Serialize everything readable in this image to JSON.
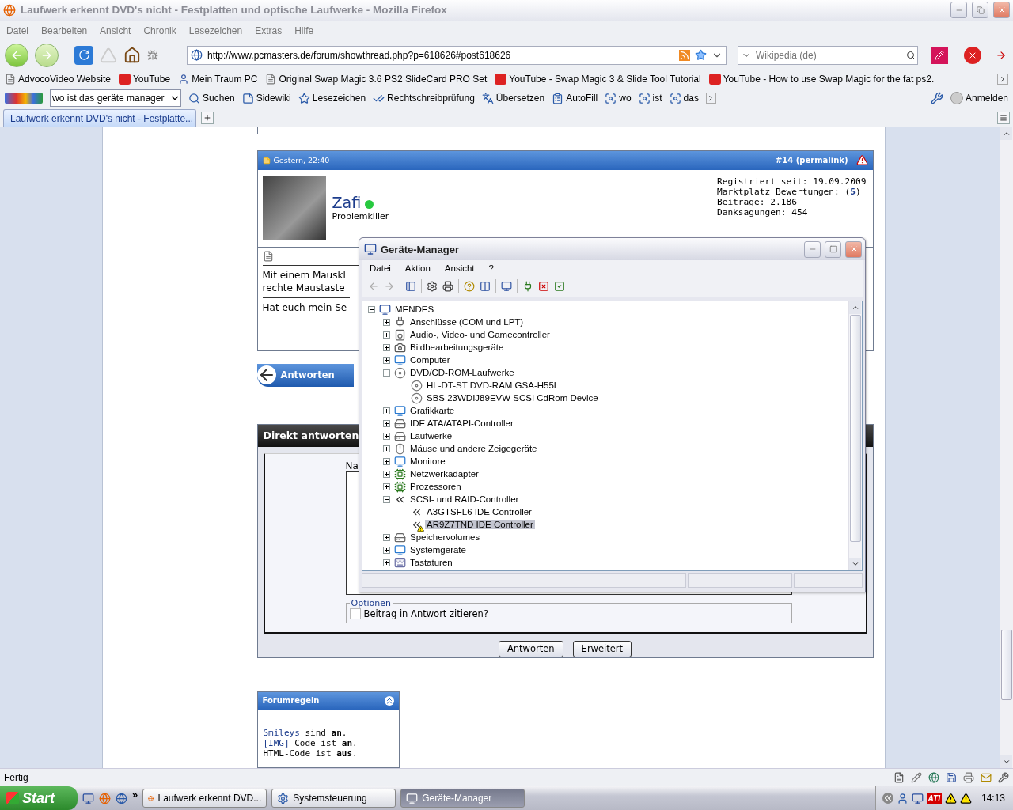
{
  "browser": {
    "title": "Laufwerk erkennt DVD's nicht - Festplatten und optische Laufwerke - Mozilla Firefox",
    "menu": [
      "Datei",
      "Bearbeiten",
      "Ansicht",
      "Chronik",
      "Lesezeichen",
      "Extras",
      "Hilfe"
    ],
    "url": "http://www.pcmasters.de/forum/showthread.php?p=618626#post618626",
    "search_placeholder": "Wikipedia (de)",
    "bookmarks": [
      {
        "label": "AdvocoVideo Website",
        "kind": "page"
      },
      {
        "label": "YouTube",
        "kind": "video"
      },
      {
        "label": "Mein Traum PC",
        "kind": "person"
      },
      {
        "label": "Original Swap Magic 3.6 PS2 SlideCard PRO Set",
        "kind": "page"
      },
      {
        "label": "YouTube - Swap Magic 3 & Slide Tool Tutorial",
        "kind": "video"
      },
      {
        "label": "YouTube - How to use Swap Magic for the fat ps2.",
        "kind": "video"
      }
    ],
    "google_query": "wo ist das geräte manager",
    "google_items": [
      {
        "label": "Suchen",
        "kind": "search"
      },
      {
        "label": "Sidewiki",
        "kind": "note"
      },
      {
        "label": "Lesezeichen",
        "kind": "star"
      },
      {
        "label": "Rechtschreibprüfung",
        "kind": "check"
      },
      {
        "label": "Übersetzen",
        "kind": "translate"
      },
      {
        "label": "AutoFill",
        "kind": "form"
      },
      {
        "label": "wo",
        "kind": "find"
      },
      {
        "label": "ist",
        "kind": "find"
      },
      {
        "label": "das",
        "kind": "find"
      }
    ],
    "sign_in": "Anmelden",
    "tabs": [
      {
        "label": "Laufwerk erkennt DVD's nicht - Festplatte...",
        "selected": true
      }
    ],
    "status": "Fertig"
  },
  "post": {
    "date": "Gestern, 22:40",
    "permalink": "#14 (permalink)",
    "user": "Zafi",
    "online": true,
    "rank": "Problemkiller",
    "stats": [
      "Registriert seit: 19.09.2009",
      "Marktplatz Bewertungen: (**5**)",
      "Beiträge: 2.186",
      "Danksagungen: 454"
    ],
    "lines": [
      "Mit einem Mauskl",
      "rechte Maustaste",
      "Hat euch mein Se"
    ]
  },
  "reply_button": "Antworten",
  "quick_reply": {
    "title": "Direkt antworten",
    "label": "Na",
    "options_legend": "Optionen",
    "quote_label": "Beitrag in Antwort zitieren?",
    "quote_checked": false,
    "buttons": [
      "Antworten",
      "Erweitert"
    ]
  },
  "forum_rules": {
    "title": "Forumregeln",
    "lines": [
      {
        "link": "Smileys",
        "text": " sind **an**."
      },
      {
        "link": "[IMG]",
        "text": " Code ist **an**."
      },
      {
        "text": "HTML-Code ist **aus**."
      }
    ]
  },
  "device_manager": {
    "title": "Geräte-Manager",
    "menu": [
      "Datei",
      "Aktion",
      "Ansicht",
      "?"
    ],
    "tree": {
      "label": "MENDES",
      "kind": "computer",
      "expanded": true,
      "selected": false,
      "children": [
        {
          "label": "Anschlüsse (COM und LPT)",
          "kind": "plug",
          "expanded": false,
          "selected": false
        },
        {
          "label": "Audio-, Video- und Gamecontroller",
          "kind": "speaker",
          "expanded": false,
          "selected": false
        },
        {
          "label": "Bildbearbeitungsgeräte",
          "kind": "camera",
          "expanded": false,
          "selected": false
        },
        {
          "label": "Computer",
          "kind": "monitor",
          "expanded": false,
          "selected": false
        },
        {
          "label": "DVD/CD-ROM-Laufwerke",
          "kind": "disc",
          "expanded": true,
          "selected": false,
          "children": [
            {
              "label": "HL-DT-ST DVD-RAM GSA-H55L",
              "kind": "disc",
              "selected": false,
              "warning": false
            },
            {
              "label": "SBS 23WDIJ89EVW SCSI CdRom Device",
              "kind": "disc",
              "selected": false,
              "warning": false
            }
          ]
        },
        {
          "label": "Grafikkarte",
          "kind": "monitor",
          "expanded": false,
          "selected": false
        },
        {
          "label": "IDE ATA/ATAPI-Controller",
          "kind": "drive",
          "expanded": false,
          "selected": false
        },
        {
          "label": "Laufwerke",
          "kind": "drive",
          "expanded": false,
          "selected": false
        },
        {
          "label": "Mäuse und andere Zeigegeräte",
          "kind": "mouse",
          "expanded": false,
          "selected": false
        },
        {
          "label": "Monitore",
          "kind": "monitor",
          "expanded": false,
          "selected": false
        },
        {
          "label": "Netzwerkadapter",
          "kind": "chip",
          "expanded": false,
          "selected": false
        },
        {
          "label": "Prozessoren",
          "kind": "chip",
          "expanded": false,
          "selected": false
        },
        {
          "label": "SCSI- und RAID-Controller",
          "kind": "controller",
          "expanded": true,
          "selected": false,
          "children": [
            {
              "label": "A3GTSFL6 IDE Controller",
              "kind": "controller",
              "selected": false,
              "warning": false
            },
            {
              "label": "AR9Z7TND IDE Controller",
              "kind": "controller",
              "selected": true,
              "warning": true
            }
          ]
        },
        {
          "label": "Speichervolumes",
          "kind": "drive",
          "expanded": false,
          "selected": false
        },
        {
          "label": "Systemgeräte",
          "kind": "monitor",
          "expanded": false,
          "selected": false
        },
        {
          "label": "Tastaturen",
          "kind": "keyboard",
          "expanded": false,
          "selected": false
        }
      ]
    }
  },
  "taskbar": {
    "start": "Start",
    "more": "»",
    "tasks": [
      {
        "label": "Laufwerk erkennt DVD...",
        "kind": "browser",
        "selected": false
      },
      {
        "label": "Systemsteuerung",
        "kind": "panel",
        "selected": false
      },
      {
        "label": "Geräte-Manager",
        "kind": "computer",
        "selected": true
      }
    ],
    "tray_badge": "ATI",
    "clock": "14:13"
  }
}
